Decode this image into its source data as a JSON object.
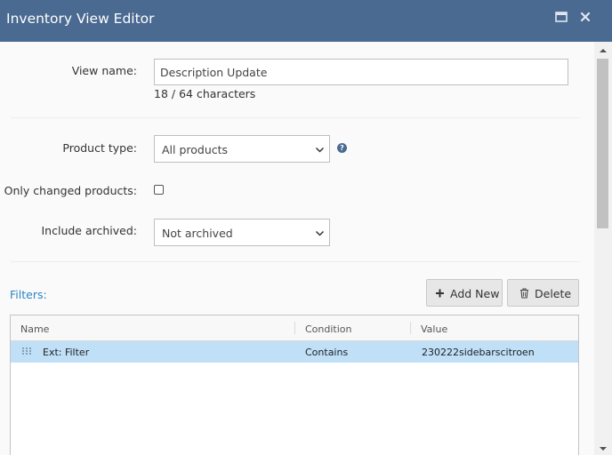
{
  "window": {
    "title": "Inventory View Editor",
    "maximize_icon": "maximize-icon",
    "close_icon": "close-icon"
  },
  "form": {
    "view_name": {
      "label": "View name:",
      "value": "Description Update",
      "char_count": "18 / 64 characters"
    },
    "product_type": {
      "label": "Product type:",
      "selected": "All products",
      "help_icon": "help-icon"
    },
    "only_changed": {
      "label": "Only changed products:",
      "checked": false
    },
    "include_archived": {
      "label": "Include archived:",
      "selected": "Not archived"
    }
  },
  "filters": {
    "label": "Filters:",
    "add_new_label": "Add New",
    "delete_label": "Delete",
    "columns": [
      "Name",
      "Condition",
      "Value"
    ],
    "rows": [
      {
        "name": "Ext: Filter",
        "condition": "Contains",
        "value": "230222sidebarscitroen",
        "selected": true
      }
    ]
  },
  "colors": {
    "titlebar": "#4a6a91",
    "accent_link": "#2a84c6",
    "selected_row": "#bfe0f7"
  }
}
